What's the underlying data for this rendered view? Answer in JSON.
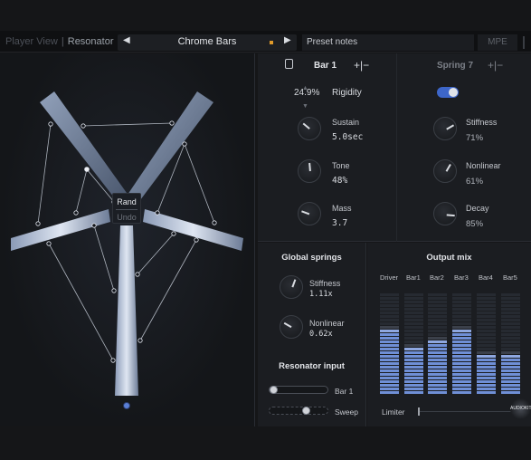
{
  "topbar": {
    "view_label": "Player View",
    "tab_label": "Resonator",
    "preset_name": "Chrome Bars",
    "prev_icon": "triangle-left-icon",
    "next_icon": "triangle-right-icon",
    "preset_notes": "Preset notes",
    "mpe_label": "MPE",
    "modified_color": "#e09a2a"
  },
  "resonator": {
    "rand_label": "Rand",
    "undo_label": "Undo"
  },
  "bar_panel": {
    "title": "Bar 1",
    "add_remove": "+|−",
    "rigidity_value": "24.9%",
    "rigidity_label": "Rigidity",
    "knobs": [
      {
        "label": "Sustain",
        "value": "5.0sec",
        "level": 0.35
      },
      {
        "label": "Tone",
        "value": "48%",
        "level": 0.48
      },
      {
        "label": "Mass",
        "value": "3.7",
        "level": 0.3
      }
    ]
  },
  "spring_panel": {
    "title": "Spring 7",
    "add_remove": "+|−",
    "toggle_on": true,
    "toggle_color": "#3d66c9",
    "knobs": [
      {
        "label": "Stiffness",
        "value": "71%",
        "level": 0.71
      },
      {
        "label": "Nonlinear",
        "value": "61%",
        "level": 0.61
      },
      {
        "label": "Decay",
        "value": "85%",
        "level": 0.85
      }
    ]
  },
  "global_springs": {
    "title": "Global springs",
    "knobs": [
      {
        "label": "Stiffness",
        "value": "1.11x",
        "level": 0.55
      },
      {
        "label": "Nonlinear",
        "value": "0.62x",
        "level": 0.3
      }
    ]
  },
  "resonator_input": {
    "title": "Resonator input",
    "sliders": [
      {
        "label": "Bar 1",
        "level": 0.0
      },
      {
        "label": "Sweep",
        "level": 0.62
      }
    ]
  },
  "output_mix": {
    "title": "Output mix",
    "channels": [
      "Driver",
      "Bar1",
      "Bar2",
      "Bar3",
      "Bar4",
      "Bar5"
    ],
    "levels": [
      0.63,
      0.47,
      0.52,
      0.63,
      0.4,
      0.4
    ],
    "limiter_label": "Limiter",
    "meter_color": "#6f8fd6",
    "logo_text": "AUDIOKIT"
  }
}
